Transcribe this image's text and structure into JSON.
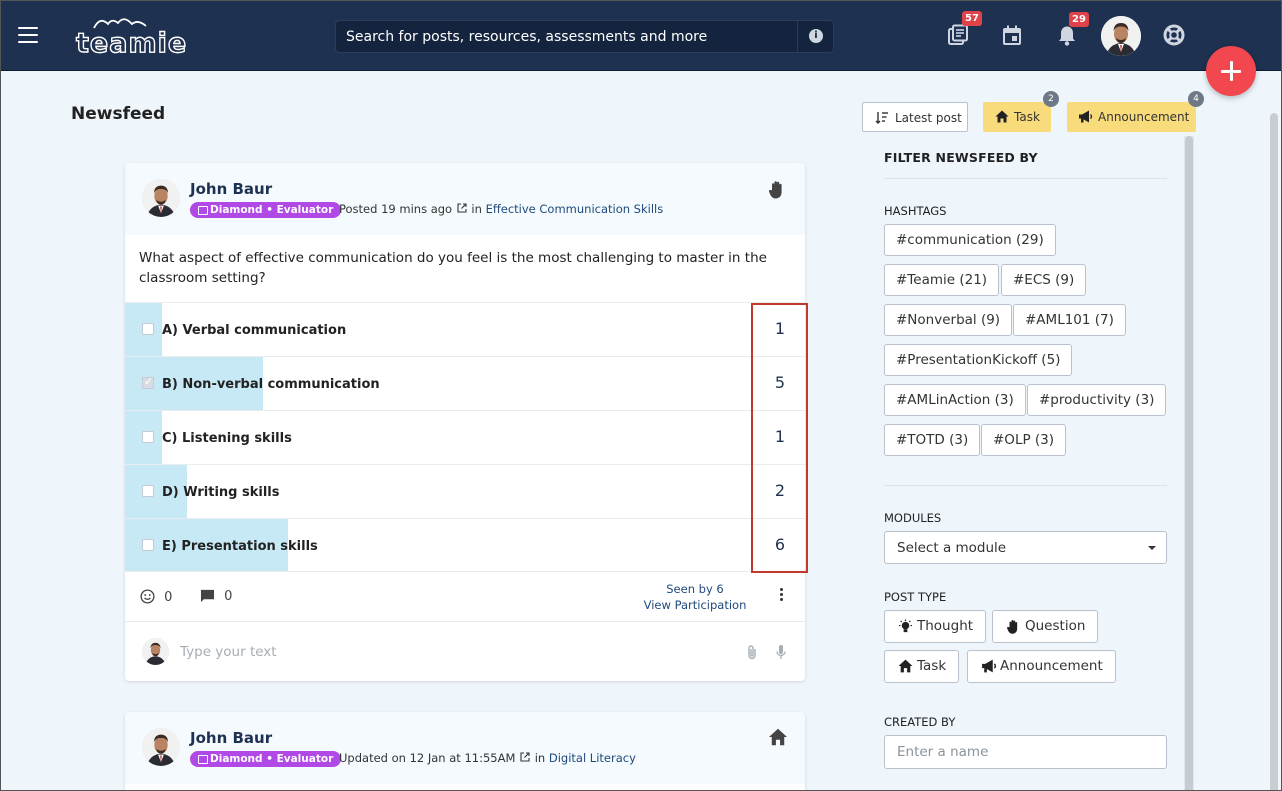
{
  "header": {
    "logo_text": "teamie",
    "search_placeholder": "Search for posts, resources, assessments and more",
    "badges": {
      "resources": "57",
      "notifications": "29"
    }
  },
  "page": {
    "title": "Newsfeed"
  },
  "toolbar": {
    "sort_label": "Latest post",
    "task_label": "Task",
    "task_count": "2",
    "announcement_label": "Announcement",
    "announcement_count": "4"
  },
  "post1": {
    "author": "John Baur",
    "role": "Diamond • Evaluator",
    "posted": "Posted 19 mins ago",
    "in_text": "in",
    "group": "Effective Communication Skills",
    "question": "What aspect of effective communication do you feel is the most challenging to master in the classroom setting?",
    "options": [
      {
        "label": "A) Verbal communication",
        "votes": "1",
        "share": 1,
        "checked": false
      },
      {
        "label": "B) Non-verbal communication",
        "votes": "5",
        "share": 5,
        "checked": true
      },
      {
        "label": "C) Listening skills",
        "votes": "1",
        "share": 1,
        "checked": false
      },
      {
        "label": "D) Writing skills",
        "votes": "2",
        "share": 2,
        "checked": false
      },
      {
        "label": "E) Presentation skills",
        "votes": "6",
        "share": 6,
        "checked": false
      }
    ],
    "reactions": "0",
    "comments": "0",
    "seen": "Seen by 6",
    "participation": "View Participation",
    "reply_placeholder": "Type your text"
  },
  "post2": {
    "author": "John Baur",
    "role": "Diamond • Evaluator",
    "updated": "Updated on 12 Jan at 11:55AM",
    "in_text": "in",
    "group": "Digital Literacy"
  },
  "sidebar": {
    "title": "FILTER NEWSFEED BY",
    "hashtags_label": "HASHTAGS",
    "hashtags": [
      "#communication (29)",
      "#Teamie (21)",
      "#ECS (9)",
      "#Nonverbal (9)",
      "#AML101 (7)",
      "#PresentationKickoff (5)",
      "#AMLinAction (3)",
      "#productivity (3)",
      "#TOTD (3)",
      "#OLP (3)"
    ],
    "modules_label": "MODULES",
    "module_select": "Select a module",
    "post_type_label": "POST TYPE",
    "post_types": [
      "Thought",
      "Question",
      "Task",
      "Announcement"
    ],
    "created_by_label": "CREATED BY",
    "created_by_placeholder": "Enter a name"
  },
  "colors": {
    "header_bg": "#1f3150",
    "accent_red": "#f2474f",
    "role_badge": "#b149e6",
    "poll_fill": "#c6e9f5",
    "task_button": "#f8dc7c",
    "highlight_box": "#c0392b"
  }
}
